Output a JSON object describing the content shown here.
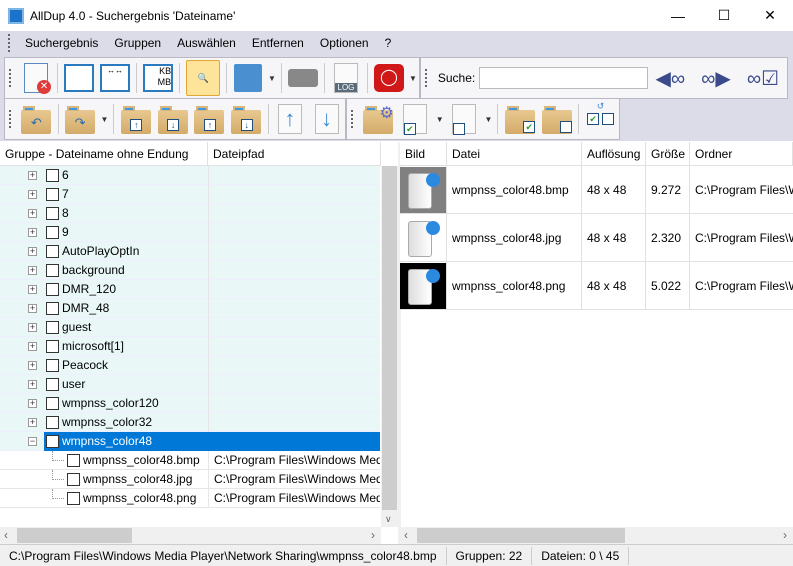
{
  "window": {
    "title": "AllDup 4.0 - Suchergebnis 'Dateiname'"
  },
  "menu": [
    "Suchergebnis",
    "Gruppen",
    "Auswählen",
    "Entfernen",
    "Optionen",
    "?"
  ],
  "toolbar": {
    "search_label": "Suche:",
    "search_value": "",
    "kbmb_label": "KB MB",
    "log_label": "LOG"
  },
  "left": {
    "columns": [
      "Gruppe - Dateiname ohne Endung",
      "Dateipfad"
    ],
    "groups": [
      "6",
      "7",
      "8",
      "9",
      "AutoPlayOptIn",
      "background",
      "DMR_120",
      "DMR_48",
      "guest",
      "microsoft[1]",
      "Peacock",
      "user",
      "wmpnss_color120",
      "wmpnss_color32",
      "wmpnss_color48"
    ],
    "selected_group": "wmpnss_color48",
    "children": [
      {
        "name": "wmpnss_color48.bmp",
        "path": "C:\\Program Files\\Windows Media Player\\Network Sharing"
      },
      {
        "name": "wmpnss_color48.jpg",
        "path": "C:\\Program Files\\Windows Media Player\\Network Sharing"
      },
      {
        "name": "wmpnss_color48.png",
        "path": "C:\\Program Files\\Windows Media Player\\Network Sharing"
      }
    ]
  },
  "right": {
    "columns": [
      "Bild",
      "Datei",
      "Auflösung",
      "Größe",
      "Ordner"
    ],
    "rows": [
      {
        "file": "wmpnss_color48.bmp",
        "res": "48 x 48",
        "size": "9.272",
        "folder": "C:\\Program Files\\Windows Media Player\\Network Sharing",
        "thumb_bg": "#808080"
      },
      {
        "file": "wmpnss_color48.jpg",
        "res": "48 x 48",
        "size": "2.320",
        "folder": "C:\\Program Files\\Windows Media Player\\Network Sharing",
        "thumb_bg": "#ffffff"
      },
      {
        "file": "wmpnss_color48.png",
        "res": "48 x 48",
        "size": "5.022",
        "folder": "C:\\Program Files\\Windows Media Player\\Network Sharing",
        "thumb_bg": "#000000"
      }
    ]
  },
  "status": {
    "path": "C:\\Program Files\\Windows Media Player\\Network Sharing\\wmpnss_color48.bmp",
    "groups": "Gruppen: 22",
    "files": "Dateien: 0 \\ 45"
  }
}
